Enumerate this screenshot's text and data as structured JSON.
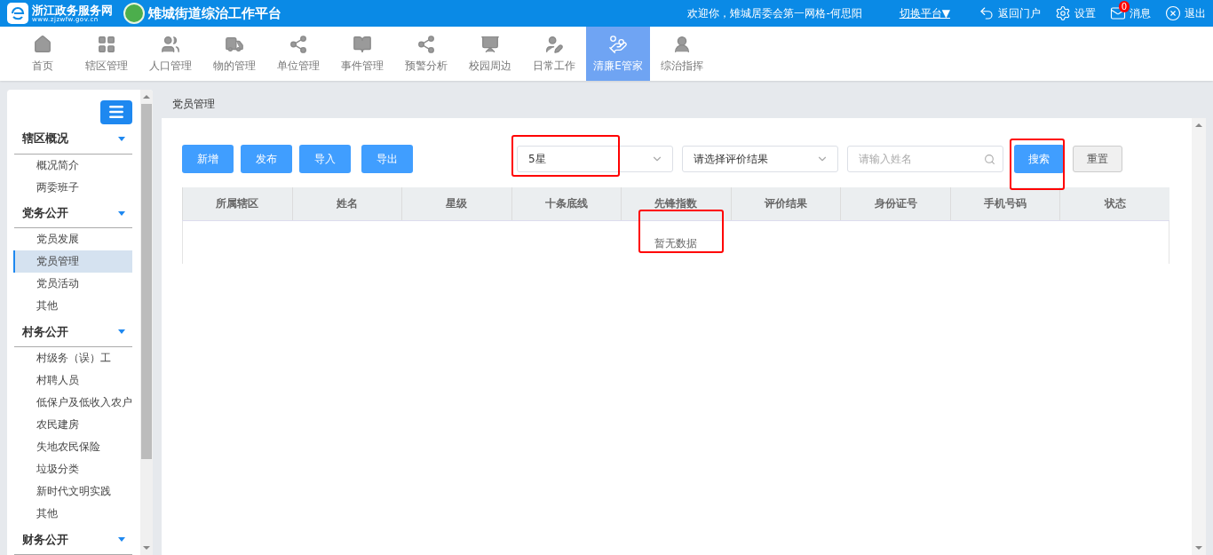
{
  "header": {
    "portal_name": "浙江政务服务网",
    "portal_url": "www.zjzwfw.gov.cn",
    "platform_title": "雉城街道综治工作平台",
    "welcome": "欢迎你，雉城居委会第一网格-何思阳",
    "switch_platform": "切换平台▼",
    "actions": [
      {
        "kind": "back",
        "label": "返回门户"
      },
      {
        "kind": "settings",
        "label": "设置"
      },
      {
        "kind": "mail",
        "label": "消息",
        "badge": "0"
      },
      {
        "kind": "logout",
        "label": "退出"
      }
    ]
  },
  "nav": [
    {
      "kind": "home",
      "label": "首页",
      "selected": false
    },
    {
      "kind": "grid",
      "label": "辖区管理",
      "selected": false
    },
    {
      "kind": "users",
      "label": "人口管理",
      "selected": false
    },
    {
      "kind": "truck",
      "label": "物的管理",
      "selected": false
    },
    {
      "kind": "network",
      "label": "单位管理",
      "selected": false
    },
    {
      "kind": "book",
      "label": "事件管理",
      "selected": false
    },
    {
      "kind": "network",
      "label": "预警分析",
      "selected": false
    },
    {
      "kind": "board",
      "label": "校园周边",
      "selected": false
    },
    {
      "kind": "user-pen",
      "label": "日常工作",
      "selected": false
    },
    {
      "kind": "hands",
      "label": "清廉E管家",
      "selected": true
    },
    {
      "kind": "officer",
      "label": "综治指挥",
      "selected": false
    }
  ],
  "sidebar": [
    {
      "label": "辖区概况",
      "expanded": true,
      "children": [
        {
          "label": "概况简介",
          "selected": false
        },
        {
          "label": "两委班子",
          "selected": false
        }
      ]
    },
    {
      "label": "党务公开",
      "expanded": true,
      "children": [
        {
          "label": "党员发展",
          "selected": false
        },
        {
          "label": "党员管理",
          "selected": true
        },
        {
          "label": "党员活动",
          "selected": false
        },
        {
          "label": "其他",
          "selected": false
        }
      ]
    },
    {
      "label": "村务公开",
      "expanded": true,
      "children": [
        {
          "label": "村级务（误）工",
          "selected": false
        },
        {
          "label": "村聘人员",
          "selected": false
        },
        {
          "label": "低保户及低收入农户",
          "selected": false
        },
        {
          "label": "农民建房",
          "selected": false
        },
        {
          "label": "失地农民保险",
          "selected": false
        },
        {
          "label": "垃圾分类",
          "selected": false
        },
        {
          "label": "新时代文明实践",
          "selected": false
        },
        {
          "label": "其他",
          "selected": false
        }
      ]
    },
    {
      "label": "财务公开",
      "expanded": true
    }
  ],
  "breadcrumb": "党员管理",
  "toolbar": {
    "buttons": [
      "新增",
      "发布",
      "导入",
      "导出"
    ],
    "rating_select": {
      "value": "5星",
      "highlighted": true
    },
    "result_select": {
      "placeholder": "请选择评价结果"
    },
    "name_input": {
      "placeholder": "请输入姓名"
    },
    "search_button": {
      "label": "搜索",
      "highlighted": true
    },
    "reset_button": {
      "label": "重置"
    }
  },
  "table": {
    "columns": [
      "所属辖区",
      "姓名",
      "星级",
      "十条底线",
      "先锋指数",
      "评价结果",
      "身份证号",
      "手机号码",
      "状态"
    ],
    "empty_text": "暂无数据",
    "empty_highlighted": true
  }
}
